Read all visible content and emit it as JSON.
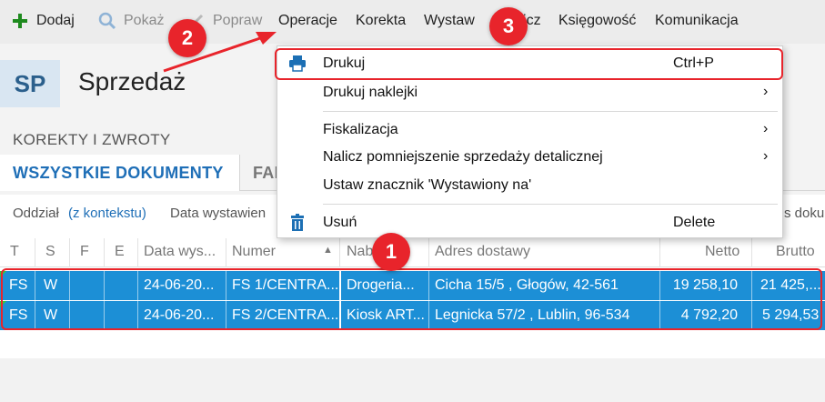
{
  "toolbar": {
    "add_label": "Dodaj",
    "show_label": "Pokaż",
    "fix_label": "Popraw",
    "operations_label": "Operacje",
    "correction_label": "Korekta",
    "issue_label": "Wystaw",
    "settle_label": "Rozlicz",
    "accounting_label": "Księgowość",
    "communication_label": "Komunikacja"
  },
  "header": {
    "badge": "SP",
    "title": "Sprzedaż"
  },
  "section": {
    "label": "KOREKTY I ZWROTY",
    "tabs": [
      {
        "label": "WSZYSTKIE DOKUMENTY"
      },
      {
        "label": "FAK"
      }
    ]
  },
  "filters": {
    "branch_label": "Oddział",
    "branch_value": "(z kontekstu)",
    "date_label": "Data wystawien",
    "right_text": "s doku"
  },
  "grid": {
    "columns": [
      "T",
      "S",
      "F",
      "E",
      "Data wys...",
      "Numer",
      "Nabywca",
      "Adres dostawy",
      "Netto",
      "Brutto"
    ],
    "rows": [
      {
        "t": "FS",
        "s": "W",
        "f": "",
        "e": "",
        "date": "24-06-20...",
        "number": "FS 1/CENTRA...",
        "buyer": "Drogeria...",
        "address": "Cicha  15/5 , Głogów, 42-561",
        "net": "19 258,10",
        "gross": "21 425,..."
      },
      {
        "t": "FS",
        "s": "W",
        "f": "",
        "e": "",
        "date": "24-06-20...",
        "number": "FS 2/CENTRA...",
        "buyer": "Kiosk ART...",
        "address": "Legnicka  57/2 , Lublin, 96-534",
        "net": "4 792,20",
        "gross": "5 294,53"
      }
    ]
  },
  "menu": {
    "items": [
      {
        "label": "Drukuj",
        "shortcut": "Ctrl+P",
        "icon": "printer-icon"
      },
      {
        "label": "Drukuj naklejki",
        "arrow": "›"
      },
      {
        "label": "Fiskalizacja",
        "arrow": "›"
      },
      {
        "label": "Nalicz pomniejszenie sprzedaży detalicznej",
        "arrow": "›"
      },
      {
        "label": "Ustaw znacznik 'Wystawiony na'"
      },
      {
        "label": "Usuń",
        "shortcut": "Delete",
        "icon": "trash-icon"
      }
    ]
  },
  "annotations": {
    "steps": [
      "1",
      "2",
      "3"
    ],
    "color": "#e8242b"
  },
  "colors": {
    "selection": "#1c8fd6",
    "accent": "#1f6fb7",
    "add_icon": "#1e8a1e"
  }
}
